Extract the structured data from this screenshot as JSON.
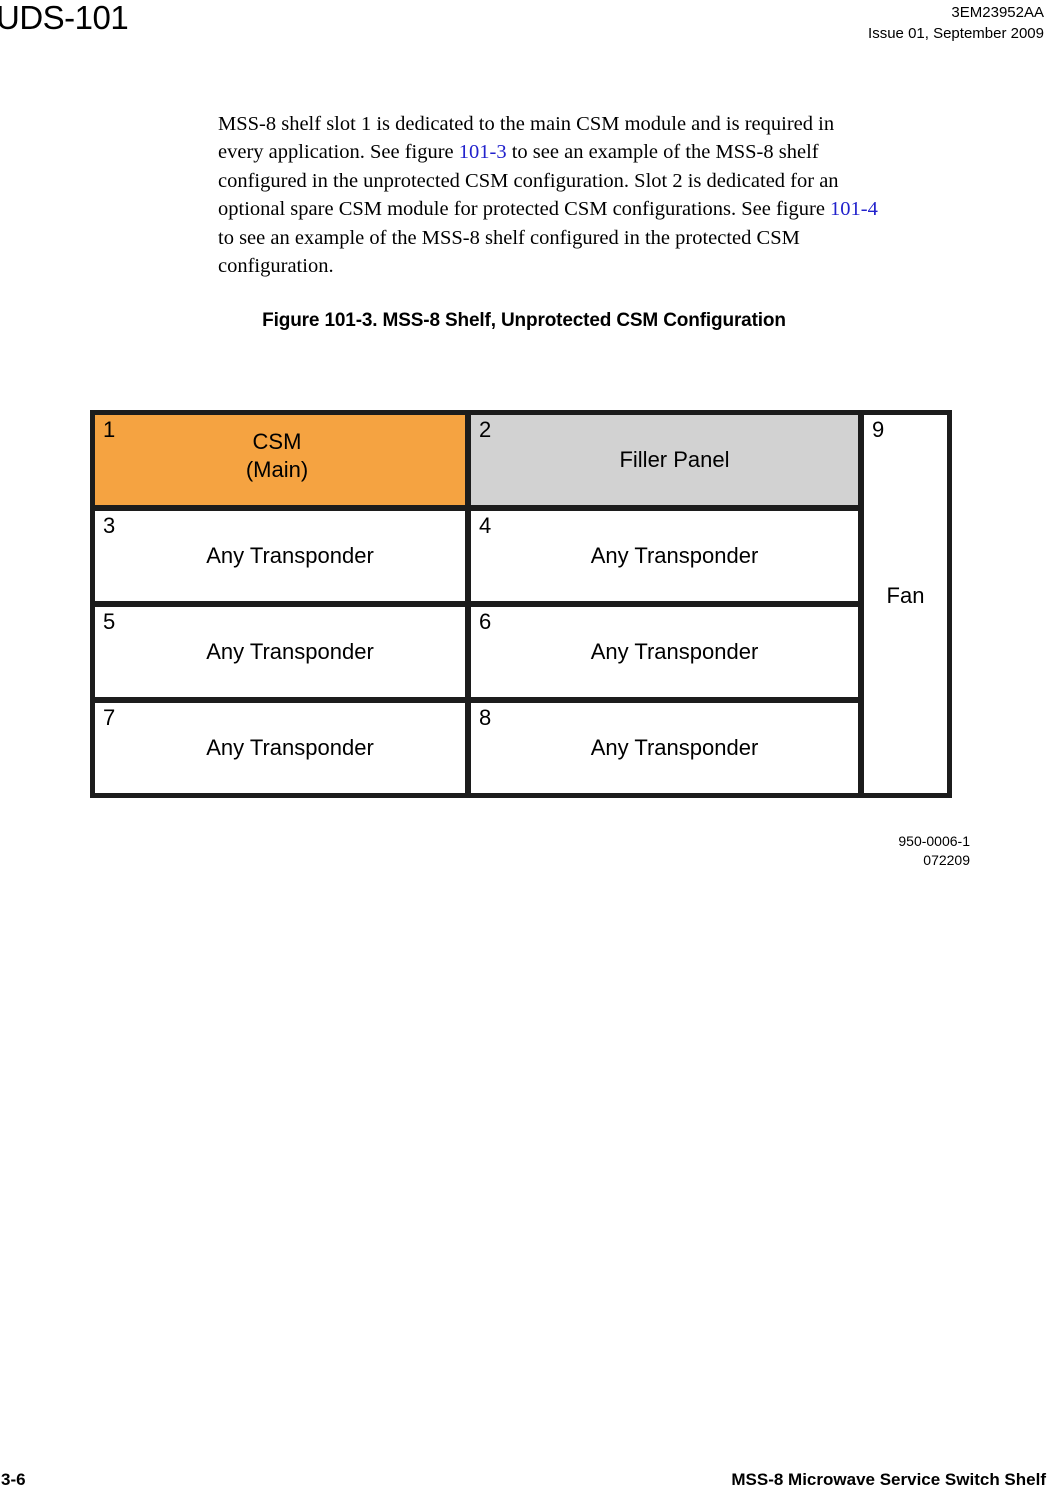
{
  "header": {
    "document_id": "UDS-101",
    "part_number": "3EM23952AA",
    "issue": "Issue 01, September 2009"
  },
  "body": {
    "paragraph_part1": "MSS-8 shelf slot 1 is dedicated to the main CSM module and is required in every application. See figure ",
    "xref1": "101-3",
    "paragraph_part2": " to see an example of the MSS-8 shelf configured in the unprotected CSM configuration. Slot 2 is dedicated for an optional spare CSM module for protected CSM configurations. See figure ",
    "xref2": "101-4",
    "paragraph_part3": " to see an example of the MSS-8 shelf configured in the protected CSM configuration."
  },
  "figure": {
    "caption": "Figure 101-3. MSS-8 Shelf, Unprotected CSM Configuration",
    "source_id": "950-0006-1",
    "source_date": "072209",
    "colors": {
      "csm_fill": "#f5a341",
      "filler_fill": "#d2d2d2",
      "empty_fill": "#ffffff",
      "border": "#1c1c1c"
    },
    "rows": [
      {
        "left": {
          "number": "1",
          "label": "CSM\n(Main)",
          "fill": "orange"
        },
        "right": {
          "number": "2",
          "label": "Filler Panel",
          "fill": "gray"
        }
      },
      {
        "left": {
          "number": "3",
          "label": "Any Transponder",
          "fill": "white"
        },
        "right": {
          "number": "4",
          "label": "Any Transponder",
          "fill": "white"
        }
      },
      {
        "left": {
          "number": "5",
          "label": "Any Transponder",
          "fill": "white"
        },
        "right": {
          "number": "6",
          "label": "Any Transponder",
          "fill": "white"
        }
      },
      {
        "left": {
          "number": "7",
          "label": "Any Transponder",
          "fill": "white"
        },
        "right": {
          "number": "8",
          "label": "Any Transponder",
          "fill": "white"
        }
      }
    ],
    "fan": {
      "number": "9",
      "label": "Fan"
    }
  },
  "footer": {
    "page_number": "3-6",
    "document_title": "MSS-8 Microwave Service Switch Shelf"
  }
}
